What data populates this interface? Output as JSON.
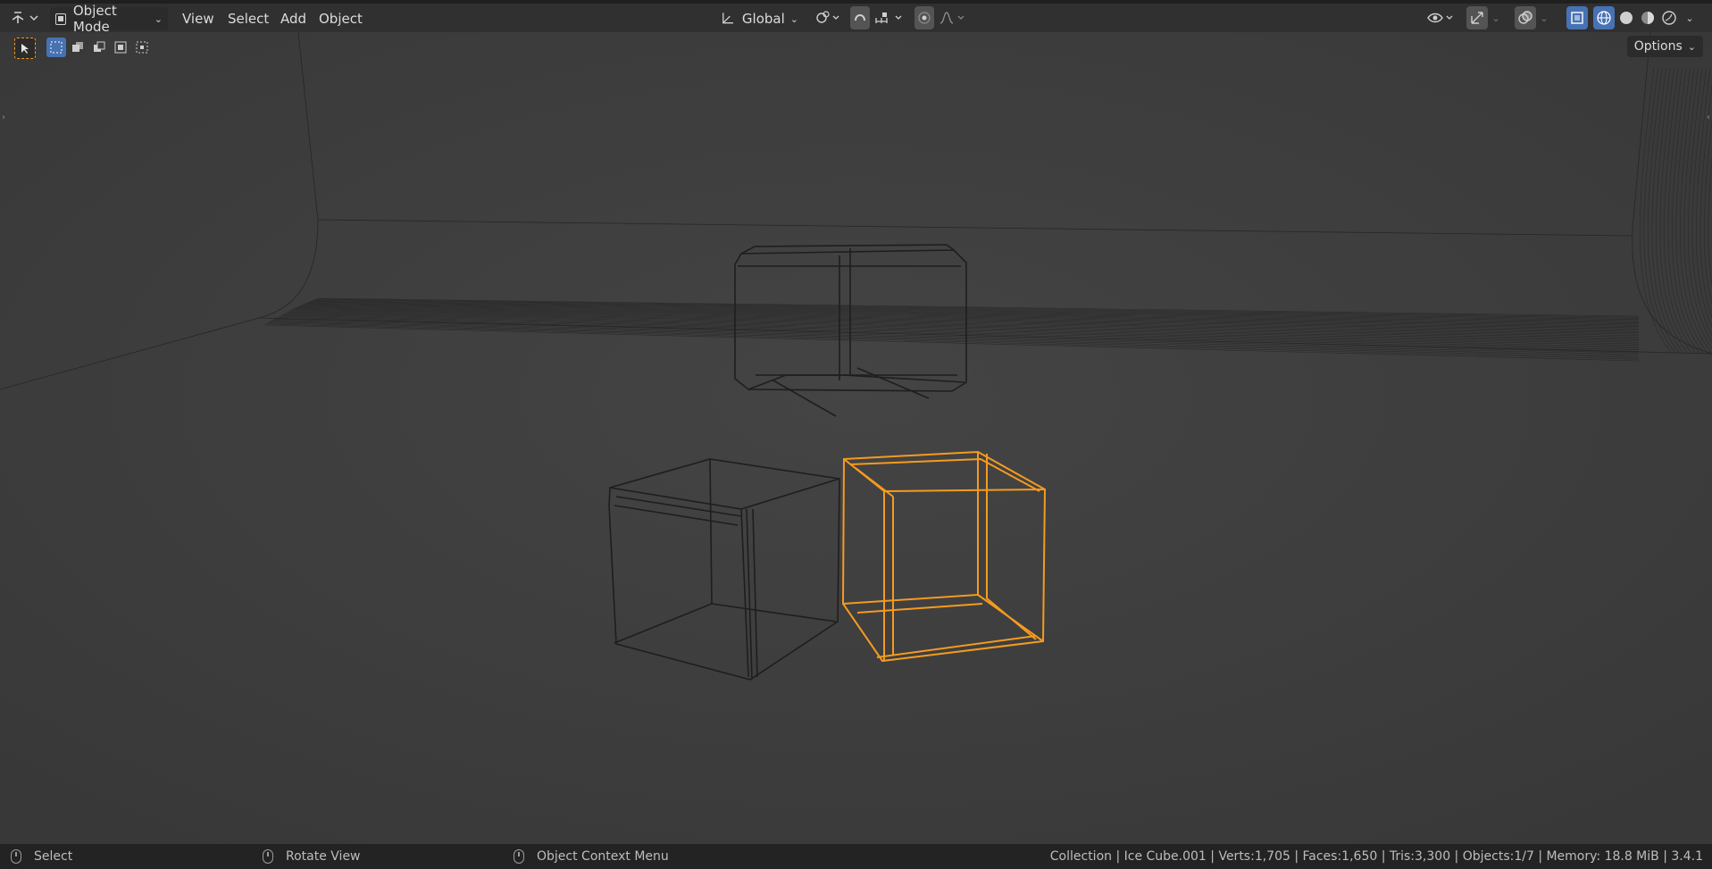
{
  "header": {
    "mode_label": "Object Mode",
    "menus": [
      "View",
      "Select",
      "Add",
      "Object"
    ],
    "orientation_label": "Global",
    "options_label": "Options"
  },
  "toolbar_icons": {
    "editor_type": "editor-type-icon",
    "snap": "snap-magnet-icon",
    "proportional": "proportional-edit-icon",
    "overlays": "overlays-icon",
    "xray": "xray-icon"
  },
  "colors": {
    "accent": "#4772b3",
    "selection": "#f59b1f",
    "viewport_bg": "#3d3d3d",
    "header_bg": "#303030"
  },
  "status": {
    "left_action": "Select",
    "middle_action": "Rotate View",
    "right_action": "Object Context Menu",
    "info": "Collection | Ice Cube.001 | Verts:1,705 | Faces:1,650 | Tris:3,300 | Objects:1/7 | Memory: 18.8 MiB | 3.4.1"
  }
}
